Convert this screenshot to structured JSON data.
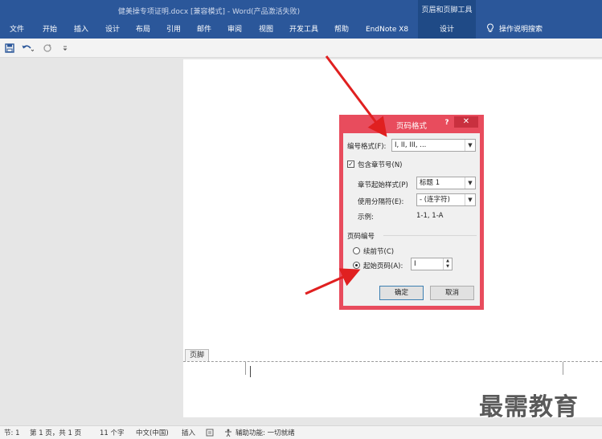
{
  "window": {
    "title": "健美操专项证明.docx [兼容模式] - Word(产品激活失败)",
    "context_tool_group": "页眉和页脚工具"
  },
  "ribbon": {
    "tabs": [
      "文件",
      "开始",
      "插入",
      "设计",
      "布局",
      "引用",
      "邮件",
      "审阅",
      "视图",
      "开发工具",
      "帮助",
      "EndNote X8"
    ],
    "context_tab": "设计",
    "tell_me": "操作说明搜索"
  },
  "qat": {
    "icons": [
      "save-icon",
      "undo-icon",
      "redo-icon",
      "customize-icon"
    ]
  },
  "document": {
    "footer_label": "页脚"
  },
  "dialog": {
    "title": "页码格式",
    "help": "?",
    "close": "✕",
    "number_format_label": "编号格式(F):",
    "number_format_value": "I, II, III, ...",
    "include_chapter_label": "包含章节号(N)",
    "include_chapter_checked": true,
    "chapter_style_label": "章节起始样式(P)",
    "chapter_style_value": "标题 1",
    "separator_label": "使用分隔符(E):",
    "separator_value": "-  (连字符)",
    "example_label": "示例:",
    "example_value": "1-1, 1-A",
    "page_numbering_group": "页码编号",
    "continue_label": "续前节(C)",
    "start_at_label": "起始页码(A):",
    "start_at_value": "I",
    "ok_label": "确定",
    "cancel_label": "取消"
  },
  "status": {
    "section": "节: 1",
    "page": "第 1 页，共 1 页",
    "words": "11 个字",
    "language": "中文(中国)",
    "mode": "插入",
    "accessibility": "辅助功能: 一切就绪"
  },
  "watermark": "最需教育",
  "colors": {
    "ribbon": "#2b579a",
    "dialog_border": "#e84c5d",
    "annotation_arrow": "#e02020"
  }
}
